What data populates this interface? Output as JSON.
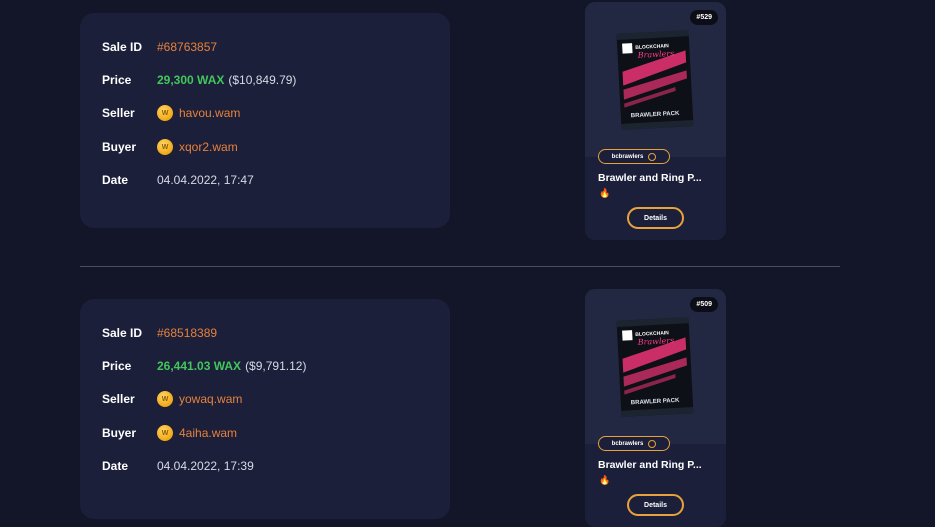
{
  "sales": [
    {
      "labels": {
        "sale_id": "Sale ID",
        "price": "Price",
        "seller": "Seller",
        "buyer": "Buyer",
        "date": "Date"
      },
      "sale_id": "#68763857",
      "price_wax": "29,300 WAX",
      "price_usd": "($10,849.79)",
      "seller": "havou.wam",
      "buyer": "xqor2.wam",
      "date": "04.04.2022, 17:47",
      "nft": {
        "mint": "#529",
        "collection": "bcbrawlers",
        "title": "Brawler and Ring P...",
        "fire": "🔥",
        "details_label": "Details"
      }
    },
    {
      "labels": {
        "sale_id": "Sale ID",
        "price": "Price",
        "seller": "Seller",
        "buyer": "Buyer",
        "date": "Date"
      },
      "sale_id": "#68518389",
      "price_wax": "26,441.03 WAX",
      "price_usd": "($9,791.12)",
      "seller": "yowaq.wam",
      "buyer": "4aiha.wam",
      "date": "04.04.2022, 17:39",
      "nft": {
        "mint": "#509",
        "collection": "bcbrawlers",
        "title": "Brawler and Ring P...",
        "fire": "🔥",
        "details_label": "Details"
      }
    }
  ],
  "pack_art": {
    "top_text": "BLOCKCHAIN",
    "script_text": "Brawlers",
    "bottom_text": "BRAWLER PACK"
  },
  "colors": {
    "background": "#131629",
    "card": "#1b1f3a",
    "accent_orange": "#e7813b",
    "wax_green": "#43c65b",
    "button_border": "#e7a23b"
  },
  "icons": {
    "wax_coin": "wax-coin-icon",
    "verified": "verified-check-icon",
    "fire": "fire-icon"
  }
}
